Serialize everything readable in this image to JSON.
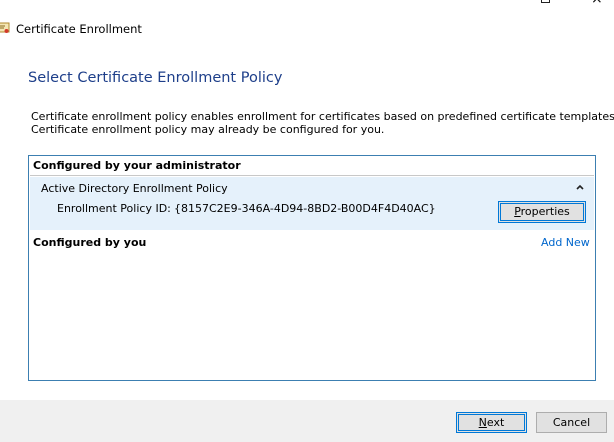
{
  "window": {
    "title": "Certificate Enrollment",
    "close_glyph": "×"
  },
  "page": {
    "title": "Select Certificate Enrollment Policy",
    "description_line1": "Certificate enrollment policy enables enrollment for certificates based on predefined certificate templates.",
    "description_line2": "Certificate enrollment policy may already be configured for you."
  },
  "policy_list": {
    "admin_section_label": "Configured by your administrator",
    "policies": [
      {
        "name": "Active Directory Enrollment Policy",
        "id_label": "Enrollment Policy ID:",
        "id_value": "{8157C2E9-346A-4D94-8BD2-B00D4F4D40AC}",
        "properties_label": "Properties",
        "expanded": true
      }
    ],
    "user_section_label": "Configured by you",
    "add_new_label": "Add New"
  },
  "footer": {
    "next_label": "Next",
    "cancel_label": "Cancel"
  },
  "colors": {
    "heading": "#1e3f8a",
    "selected_row": "#e5f1fb",
    "border_accent": "#3c7fb1",
    "link": "#0066cc"
  },
  "icons": {
    "app": "certificate-icon",
    "collapse": "chevron-up-icon",
    "maximize": "maximize-icon",
    "close": "close-icon"
  }
}
